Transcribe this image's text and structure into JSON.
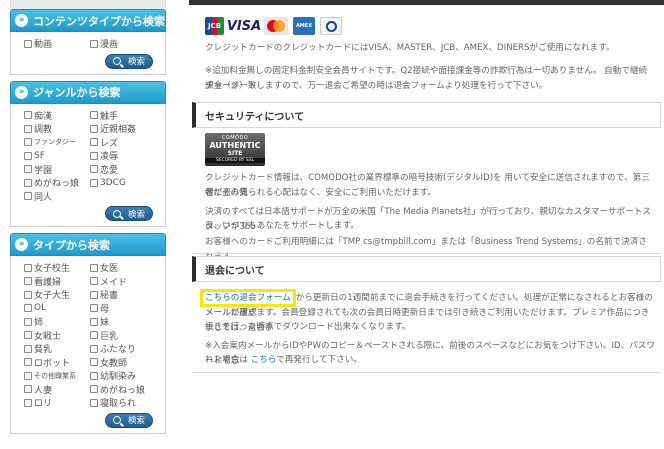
{
  "sidebar": {
    "content_type": {
      "title": "コンテンツタイプから検索",
      "items": [
        "動画",
        "漫画"
      ],
      "button": "検索"
    },
    "genre": {
      "title": "ジャンルから検索",
      "items": [
        "痴漢",
        "触手",
        "調教",
        "近親相姦",
        "ファンタジー",
        "レズ",
        "SF",
        "凌辱",
        "学園",
        "恋愛",
        "めがねっ娘",
        "3DCG",
        "同人"
      ],
      "button": "検索"
    },
    "type": {
      "title": "タイプから検索",
      "items": [
        "女子校生",
        "女医",
        "看護婦",
        "メイド",
        "女子大生",
        "秘書",
        "OL",
        "母",
        "姉",
        "妹",
        "女戦士",
        "巨乳",
        "貧乳",
        "ふたなり",
        "ロボット",
        "女教師",
        "その他職業系",
        "幼馴染み",
        "人妻",
        "めがねっ娘",
        "ロリ",
        "寝取られ"
      ],
      "button": "検索"
    }
  },
  "payment": {
    "cards": [
      "JCB",
      "VISA",
      "MasterCard",
      "AMEX",
      "Diners Club"
    ],
    "text1": "クレジットカードのクレジットカードにはVISA、MASTER、JCB、AMEX、DINERSがご使用になれます。",
    "text2_line1": "※追加料金無しの固定料金制安全会員サイトです。Q2接続や面接課金等の詐欺行為は一切ありません。 自動で継続課金（オート",
    "text2_line2": "チャージ）致しますので、万一退会ご希望の時は退会フォームより処理を行って下さい。"
  },
  "security": {
    "heading": "セキュリティについて",
    "seal": {
      "l1": "COMODO",
      "l2a": "AUTHENTIC",
      "l2b": "SITE",
      "l3": "SECURED BY SSL"
    },
    "p1_line1": "クレジットカード情報は、COMODO社の業界標準の暗号技術(デジタルID)を 用いて安全に送信されますので、第三者にその情",
    "p1_line2": "報が盗み見られる心配はなく、安全にご利用いただけます。",
    "p2_line1": "決済のすべては日本語サポートが万全の米国「The Media Planets社」が行っており、親切なカスタマーサポートスタッフが365",
    "p2_line2": "日、いつでもあなたをサポートします。",
    "p3": "お客様へのカードご利用明細には「TMP cs@tmpbill.com」または「Business Trend Systems」の名前で決済されます。"
  },
  "cancel": {
    "heading": "退会について",
    "link": "こちらの退会フォーム",
    "p1_line1_rest": "から更新日の1週間前までに退会手続きを行ってください。処理が正常になされるとお客様のメールに確認",
    "p1_line2": "メールが届きます。会員登録されても次の会員日時更新日までは引き続きご利用いただけます。プレミア作品につきましては、退会手",
    "p1_line3": "続きを行った時点でダウンロード出来なくなります。",
    "p2_line1": "※入会案内メールからIDやPWのコピー＆ペーストされる際に、前後のスペースなどにお気をつけ下さい。ID、パスワードを忘",
    "p2_line2_pre": "れた場合は ",
    "p2_link": "こちら",
    "p2_line2_post": "で再発行して下さい。"
  }
}
